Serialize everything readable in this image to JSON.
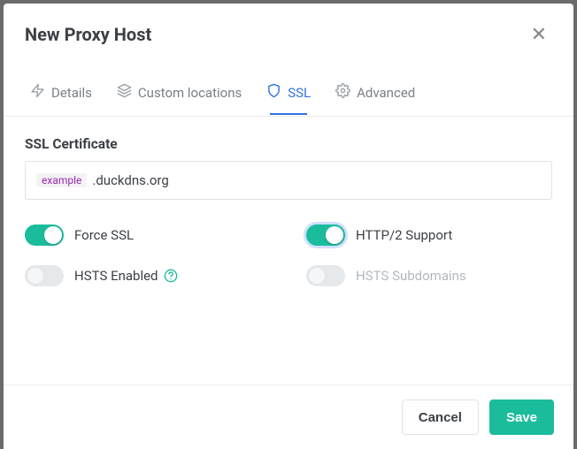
{
  "header": {
    "title": "New Proxy Host"
  },
  "tabs": {
    "details": {
      "label": "Details"
    },
    "custom": {
      "label": "Custom locations"
    },
    "ssl": {
      "label": "SSL"
    },
    "advanced": {
      "label": "Advanced"
    }
  },
  "ssl": {
    "section_title": "SSL Certificate",
    "domain_tag": "example",
    "domain_text": ".duckdns.org",
    "force_ssl_label": "Force SSL",
    "http2_label": "HTTP/2 Support",
    "hsts_enabled_label": "HSTS Enabled",
    "hsts_subdomains_label": "HSTS Subdomains"
  },
  "footer": {
    "cancel": "Cancel",
    "save": "Save"
  }
}
